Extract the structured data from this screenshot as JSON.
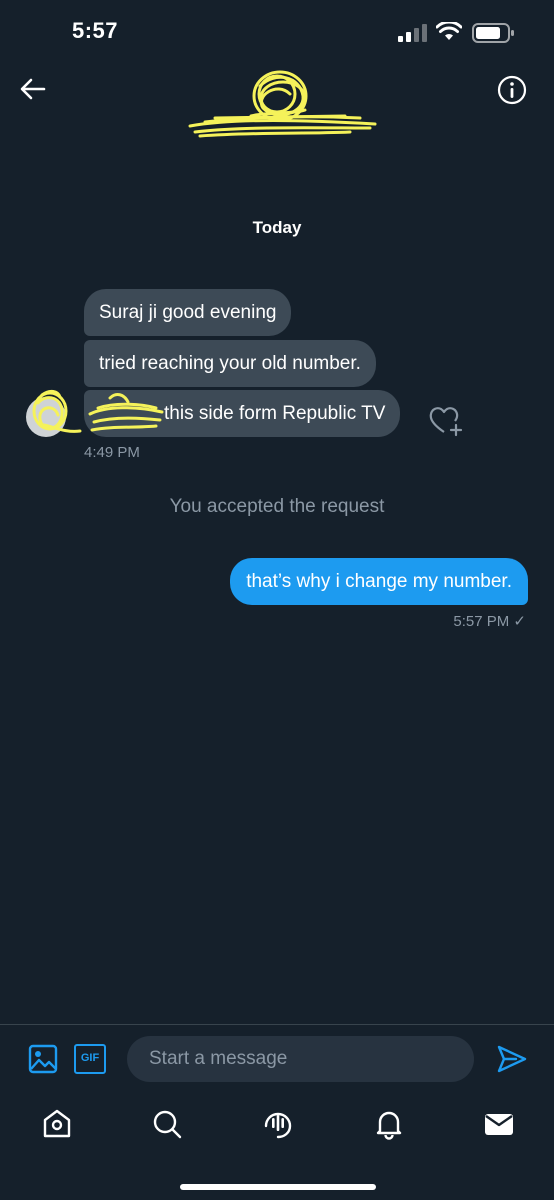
{
  "status_bar": {
    "time": "5:57"
  },
  "thread": {
    "date_separator": "Today",
    "incoming": [
      "Suraj ji good evening",
      "tried reaching your old number.",
      "this side form Republic TV"
    ],
    "incoming_time": "4:49 PM",
    "system_note": "You accepted the request",
    "outgoing": "that’s why i change my number.",
    "outgoing_time": "5:57 PM ✓"
  },
  "composer": {
    "placeholder": "Start a message",
    "gif_label": "GIF"
  },
  "colors": {
    "background": "#15202b",
    "accent": "#1d9bf0",
    "bubble_in": "#3d4a56",
    "scribble": "#f5f25a"
  },
  "icons": [
    "back-arrow-icon",
    "info-icon",
    "image-icon",
    "gif-icon",
    "send-icon",
    "home-icon",
    "search-icon",
    "spaces-icon",
    "bell-icon",
    "mail-icon",
    "heart-add-icon"
  ]
}
